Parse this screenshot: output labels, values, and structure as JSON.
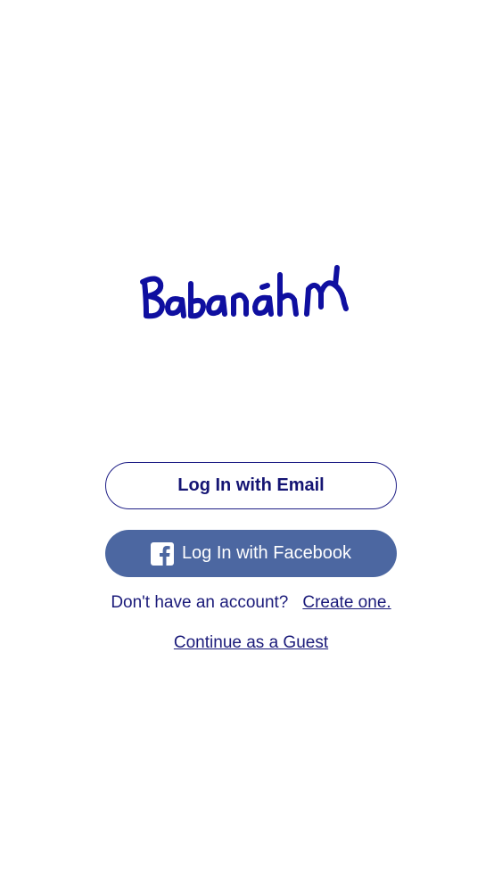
{
  "app": {
    "logo_text": "Babanahm",
    "brand_color": "#0f0fa0"
  },
  "login": {
    "email_button_label": "Log In with Email",
    "facebook_button_label": "Log In with Facebook",
    "facebook_icon": "facebook-icon",
    "facebook_color": "#4c67a1"
  },
  "signup": {
    "prompt": "Don't have an account?",
    "link_label": "Create one."
  },
  "guest": {
    "link_label": "Continue as a Guest"
  }
}
